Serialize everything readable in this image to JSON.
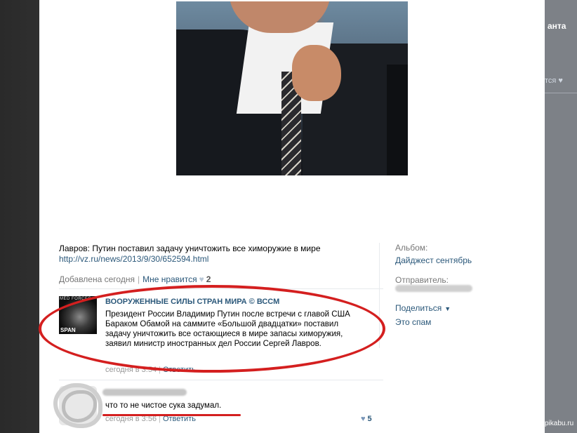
{
  "right_strip": {
    "title_fragment": "анта",
    "like_fragment": "тся ♥",
    "watermark": "pikabu.ru"
  },
  "post": {
    "text": "Лавров: Путин поставил задачу уничтожить все химоружие в мире",
    "link": "http://vz.ru/news/2013/9/30/652594.html",
    "added": "Добавлена сегодня",
    "like_label": "Мне нравится",
    "like_count": "2"
  },
  "comments": [
    {
      "author": "ВООРУЖЕННЫЕ СИЛЫ СТРАН МИРА © ВССМ",
      "avatar_text_top": "MED FORCES",
      "avatar_text_bottom": "SPAN",
      "text": "Президент России Владимир Путин после встречи с главой США Бараком Обамой на саммите «Большой двадцатки» поставил задачу уничтожить все остающиеся в мире запасы химоружия, заявил министр иностранных дел России Сергей Лавров.",
      "time": "сегодня в 3:54",
      "reply_label": "Ответить"
    },
    {
      "author": "",
      "text": "что то не чистое сука задумал.",
      "time": "сегодня в 3:56",
      "reply_label": "Ответить",
      "likes": "5"
    }
  ],
  "sidebar": {
    "album_label": "Альбом:",
    "album_value": "Дайджест сентябрь",
    "sender_label": "Отправитель:",
    "share_label": "Поделиться",
    "spam_label": "Это спам"
  },
  "colors": {
    "link": "#2b587a",
    "annotation": "#d41f1f"
  }
}
